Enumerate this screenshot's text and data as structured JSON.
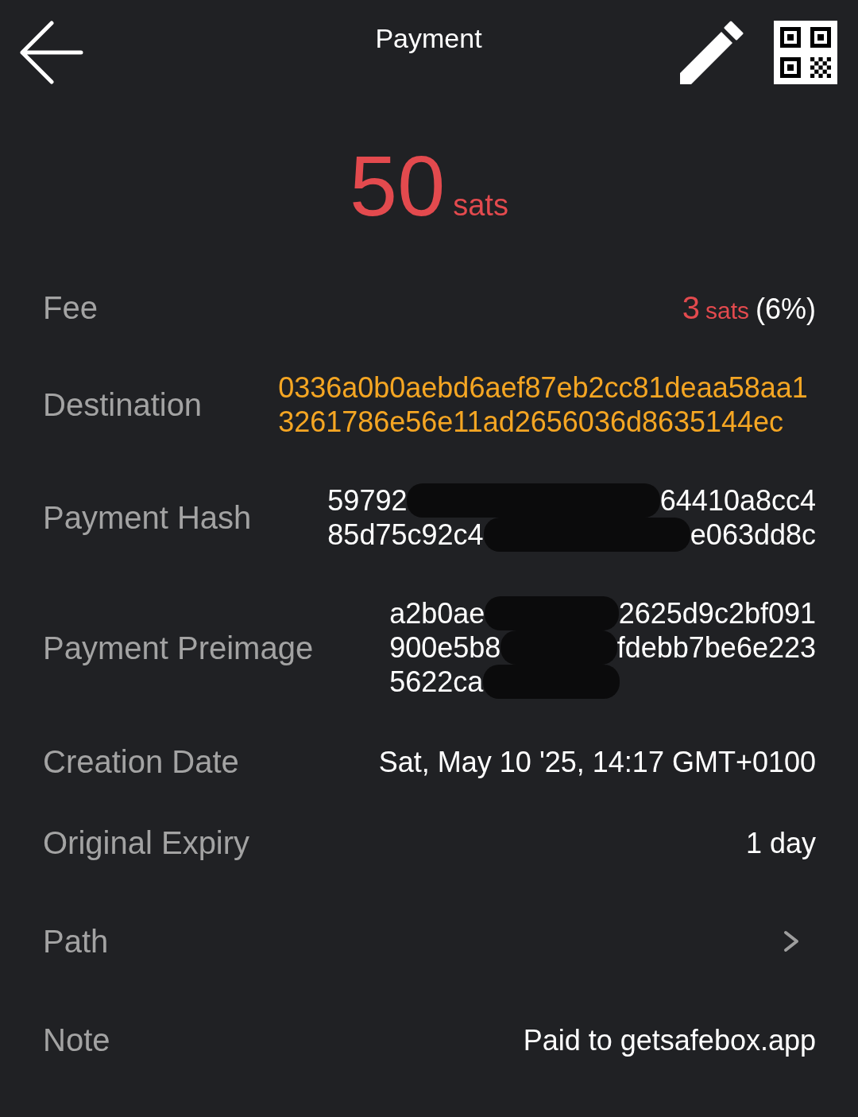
{
  "header": {
    "title": "Payment"
  },
  "amount": {
    "value": "50",
    "unit": "sats"
  },
  "rows": [
    {
      "kind": "fee",
      "label": "Fee",
      "value": "3",
      "unit": "sats",
      "percent": "(6%)"
    },
    {
      "kind": "hex",
      "label": "Destination",
      "value": "0336a0b0aebd6aef87eb2cc81deaa58aa13261786e56e11ad2656036d8635144ec"
    },
    {
      "kind": "redacted",
      "label": "Payment Hash",
      "lines": [
        [
          {
            "kind": "text",
            "text": "59792"
          },
          {
            "kind": "redacted"
          },
          {
            "kind": "text",
            "text": "64410a8cc4"
          }
        ],
        [
          {
            "kind": "text",
            "text": "85d75c92c4"
          },
          {
            "kind": "redacted"
          },
          {
            "kind": "text",
            "text": "e063dd8c"
          }
        ]
      ]
    },
    {
      "kind": "redacted",
      "label": "Payment Preimage",
      "lines": [
        [
          {
            "kind": "text",
            "text": "a2b0ae"
          },
          {
            "kind": "redacted"
          },
          {
            "kind": "text",
            "text": "2625d9c2bf091"
          }
        ],
        [
          {
            "kind": "text",
            "text": "900e5b8"
          },
          {
            "kind": "redacted"
          },
          {
            "kind": "text",
            "text": "fdebb7be6e223"
          }
        ],
        [
          {
            "kind": "text",
            "text": "5622ca"
          },
          {
            "kind": "redacted"
          }
        ]
      ]
    },
    {
      "kind": "text",
      "label": "Creation Date",
      "value": "Sat, May 10 '25, 14:17 GMT+0100"
    },
    {
      "kind": "text",
      "label": "Original Expiry",
      "value": "1 day"
    },
    {
      "kind": "link",
      "label": "Path"
    },
    {
      "kind": "text",
      "label": "Note",
      "value": "Paid to getsafebox.app"
    }
  ]
}
